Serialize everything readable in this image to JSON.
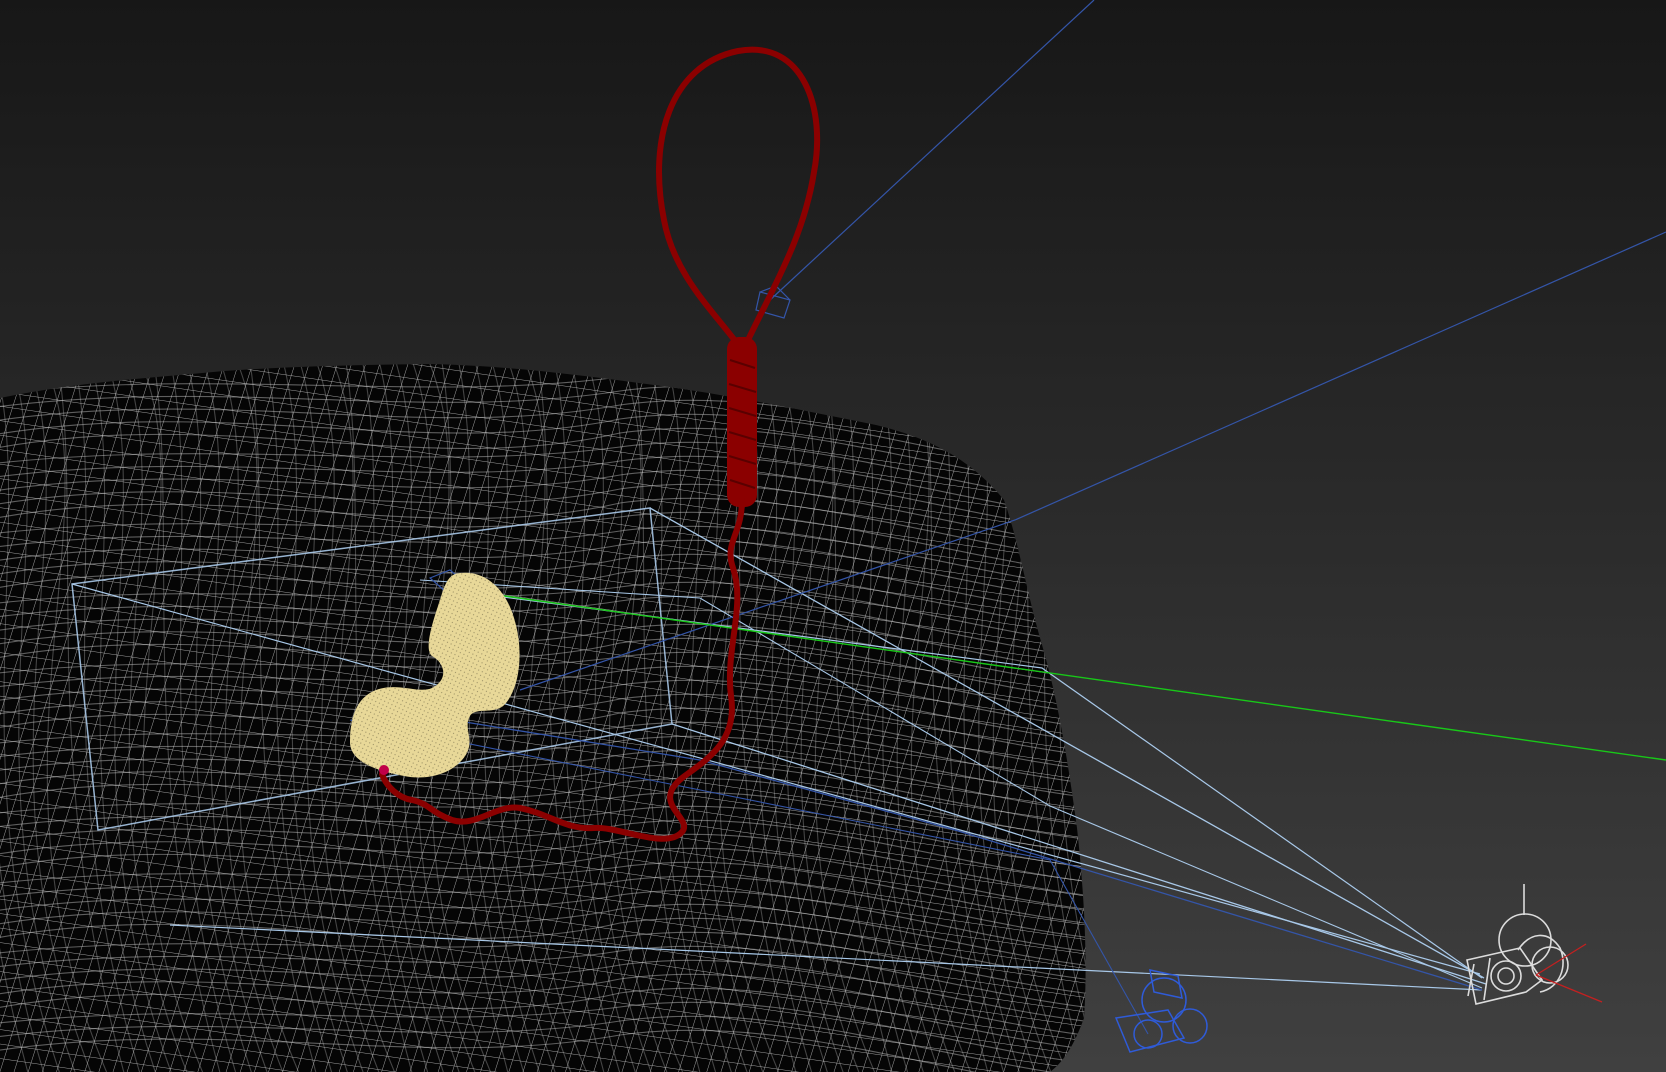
{
  "viewport": {
    "background_top": "#171717",
    "background_bottom": "#404040",
    "mesh_wire_color": "#d8d8d8",
    "mesh_fill_color": "#050505",
    "rope_color": "#8b0000",
    "handset_color": "#e8d898",
    "camera_color": "#dcdcdc",
    "selected_camera_color": "#2f5bd8",
    "blue_line_color": "#3455a8",
    "frustum_color": "#a8c8e8",
    "green_axis_color": "#18c818",
    "red_axis_color": "#c42020"
  }
}
